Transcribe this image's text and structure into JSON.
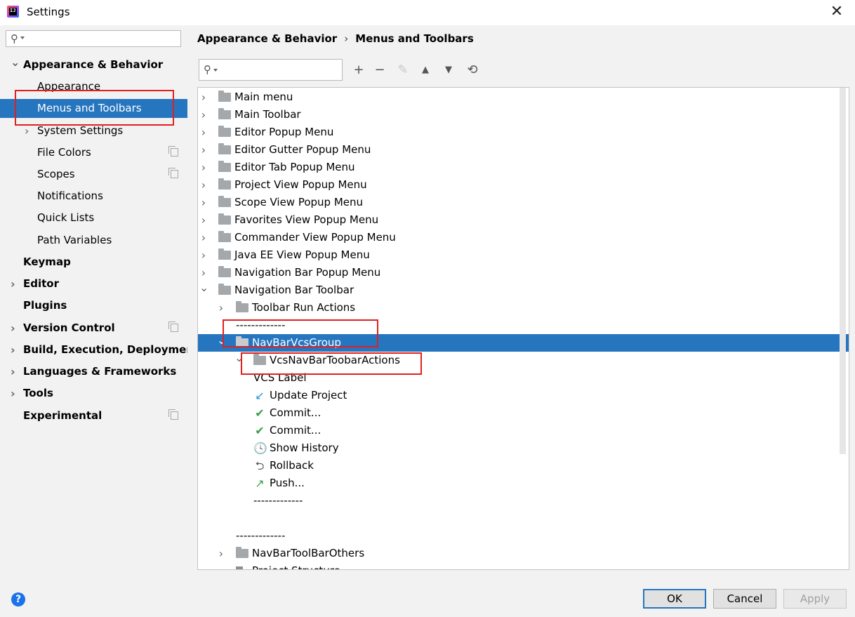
{
  "window": {
    "title": "Settings",
    "close": "✕"
  },
  "sidebar": {
    "search_placeholder": "",
    "items": [
      {
        "label": "Appearance & Behavior",
        "bold": true,
        "arrow": "down",
        "indent": 1
      },
      {
        "label": "Appearance",
        "indent": 2
      },
      {
        "label": "Menus and Toolbars",
        "indent": 2,
        "selected": true
      },
      {
        "label": "System Settings",
        "indent": 2,
        "arrow": "right"
      },
      {
        "label": "File Colors",
        "indent": 2,
        "copy": true
      },
      {
        "label": "Scopes",
        "indent": 2,
        "copy": true
      },
      {
        "label": "Notifications",
        "indent": 2
      },
      {
        "label": "Quick Lists",
        "indent": 2
      },
      {
        "label": "Path Variables",
        "indent": 2
      },
      {
        "label": "Keymap",
        "bold": true,
        "indent": 1
      },
      {
        "label": "Editor",
        "bold": true,
        "arrow": "right",
        "indent": 1
      },
      {
        "label": "Plugins",
        "bold": true,
        "indent": 1
      },
      {
        "label": "Version Control",
        "bold": true,
        "arrow": "right",
        "indent": 1,
        "copy": true
      },
      {
        "label": "Build, Execution, Deployment",
        "bold": true,
        "arrow": "right",
        "indent": 1
      },
      {
        "label": "Languages & Frameworks",
        "bold": true,
        "arrow": "right",
        "indent": 1
      },
      {
        "label": "Tools",
        "bold": true,
        "arrow": "right",
        "indent": 1
      },
      {
        "label": "Experimental",
        "bold": true,
        "indent": 1,
        "copy": true
      }
    ]
  },
  "main": {
    "breadcrumb": {
      "parent": "Appearance & Behavior",
      "separator": "›",
      "current": "Menus and Toolbars"
    },
    "toolbar": {
      "search_placeholder": ""
    },
    "tree": [
      {
        "label": "Main menu",
        "level": 0,
        "arrow": "right",
        "icon": "folder"
      },
      {
        "label": "Main Toolbar",
        "level": 0,
        "arrow": "right",
        "icon": "folder"
      },
      {
        "label": "Editor Popup Menu",
        "level": 0,
        "arrow": "right",
        "icon": "folder"
      },
      {
        "label": "Editor Gutter Popup Menu",
        "level": 0,
        "arrow": "right",
        "icon": "folder"
      },
      {
        "label": "Editor Tab Popup Menu",
        "level": 0,
        "arrow": "right",
        "icon": "folder"
      },
      {
        "label": "Project View Popup Menu",
        "level": 0,
        "arrow": "right",
        "icon": "folder"
      },
      {
        "label": "Scope View Popup Menu",
        "level": 0,
        "arrow": "right",
        "icon": "folder"
      },
      {
        "label": "Favorites View Popup Menu",
        "level": 0,
        "arrow": "right",
        "icon": "folder"
      },
      {
        "label": "Commander View Popup Menu",
        "level": 0,
        "arrow": "right",
        "icon": "folder"
      },
      {
        "label": "Java EE View Popup Menu",
        "level": 0,
        "arrow": "right",
        "icon": "folder"
      },
      {
        "label": "Navigation Bar Popup Menu",
        "level": 0,
        "arrow": "right",
        "icon": "folder"
      },
      {
        "label": "Navigation Bar Toolbar",
        "level": 0,
        "arrow": "down",
        "icon": "folder"
      },
      {
        "label": "Toolbar Run Actions",
        "level": 1,
        "arrow": "right",
        "icon": "folder"
      },
      {
        "label": "-------------",
        "level": 1,
        "icon": "none"
      },
      {
        "label": "NavBarVcsGroup",
        "level": 1,
        "arrow": "down",
        "icon": "folder",
        "selected": true
      },
      {
        "label": "VcsNavBarToobarActions",
        "level": 2,
        "arrow": "down",
        "icon": "folder"
      },
      {
        "label": "VCS Label",
        "level": 3,
        "icon": "none"
      },
      {
        "label": "Update Project",
        "level": 3,
        "icon": "update"
      },
      {
        "label": "Commit...",
        "level": 3,
        "icon": "check"
      },
      {
        "label": "Commit...",
        "level": 3,
        "icon": "check"
      },
      {
        "label": "Show History",
        "level": 3,
        "icon": "clock"
      },
      {
        "label": "Rollback",
        "level": 3,
        "icon": "rollback"
      },
      {
        "label": "Push...",
        "level": 3,
        "icon": "push"
      },
      {
        "label": "-------------",
        "level": 3,
        "icon": "none"
      },
      {
        "label": "",
        "level": 1,
        "icon": "none"
      },
      {
        "label": "-------------",
        "level": 1,
        "icon": "none"
      },
      {
        "label": "NavBarToolBarOthers",
        "level": 1,
        "arrow": "right",
        "icon": "folder"
      },
      {
        "label": "Project Structure...",
        "level": 1,
        "icon": "structure"
      }
    ]
  },
  "icons": {
    "plus": "+",
    "minus": "−",
    "edit": "✎",
    "up": "▲",
    "down": "▼",
    "restore": "⟲",
    "update": "↙",
    "check": "✔",
    "clock": "🕓",
    "rollback": "⮌",
    "push": "↗",
    "arrow_right": "›",
    "arrow_down": "⌄",
    "search": "⚲",
    "help": "?"
  },
  "colors": {
    "selection": "#2675bf",
    "annotation": "#e02020",
    "check": "#3a9c4a",
    "update": "#2a8fd6",
    "push": "#3a9c4a"
  },
  "footer": {
    "ok": "OK",
    "cancel": "Cancel",
    "apply": "Apply"
  }
}
